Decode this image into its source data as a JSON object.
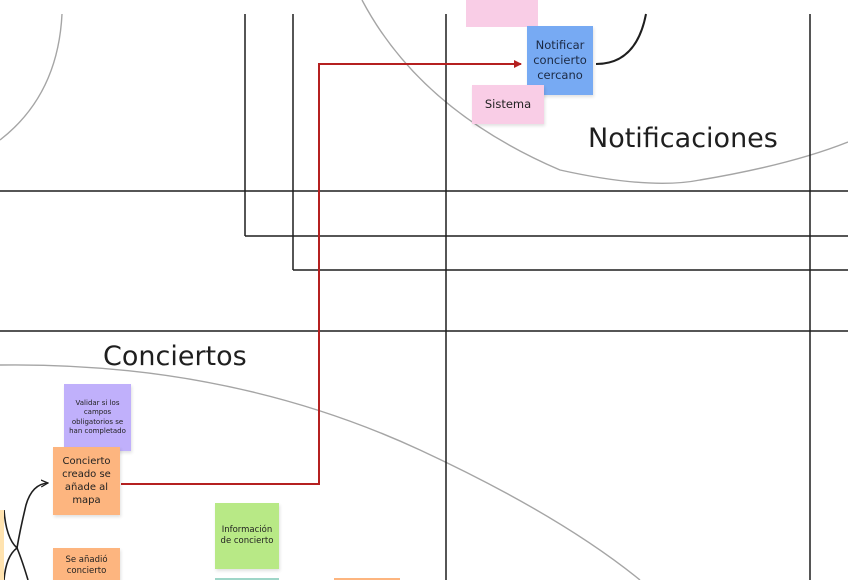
{
  "board": {
    "zones": {
      "notificaciones": "Notificaciones",
      "conciertos": "Conciertos"
    },
    "notes": {
      "notificar": "Notificar concierto cercano",
      "sistema": "Sistema",
      "validar": "Validar si los campos obligatorios se han completado",
      "creado": "Concierto creado se añade al mapa",
      "informacion": "Información de concierto",
      "anadio": "Se añadió concierto"
    }
  },
  "colors": {
    "note_blue": "#77aaf3",
    "note_pink": "#f9cde6",
    "note_purple": "#c0b0fb",
    "note_orange": "#fdb57f",
    "note_green": "#b8e986",
    "note_teal": "#9fd6c8",
    "note_edge": "#ffe3b0",
    "line_black": "#1e1e1e",
    "line_grey": "#a5a5a5",
    "connector_red": "#b52020"
  }
}
